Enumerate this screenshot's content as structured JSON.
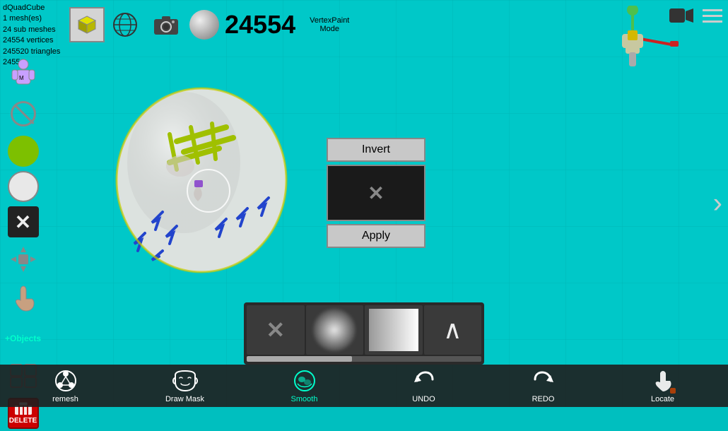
{
  "app": {
    "title": "dQuadCube",
    "mesh_count": "1 mesh(es)",
    "sub_meshes": "24 sub meshes",
    "vertices": "24554 vertices",
    "triangles": "245520 triangles",
    "vertex_id": "24554",
    "vertex_count_display": "24554",
    "vertex_paint_label": "VertexPaint",
    "mode_label": "Mode"
  },
  "popup": {
    "invert_label": "Invert",
    "apply_label": "Apply"
  },
  "bottom_toolbar": {
    "remesh_label": "remesh",
    "draw_mask_label": "Draw Mask",
    "smooth_label": "Smooth",
    "undo_label": "UNDO",
    "redo_label": "REDO",
    "locate_label": "Locate"
  },
  "sidebar": {
    "plus_objects_label": "+Objects",
    "delete_label": "DELETE"
  },
  "palette": {
    "progress_percent": 45,
    "items": [
      {
        "id": "x-brush",
        "type": "x"
      },
      {
        "id": "cloud-brush",
        "type": "cloud"
      },
      {
        "id": "gradient-brush",
        "type": "gradient"
      },
      {
        "id": "chevron-brush",
        "type": "chevron"
      }
    ]
  },
  "icons": {
    "hamburger": "menu-icon",
    "camera_video": "video-camera-icon",
    "camera_photo": "photo-camera-icon",
    "globe": "globe-icon",
    "chevron_right": "chevron-right-icon"
  }
}
